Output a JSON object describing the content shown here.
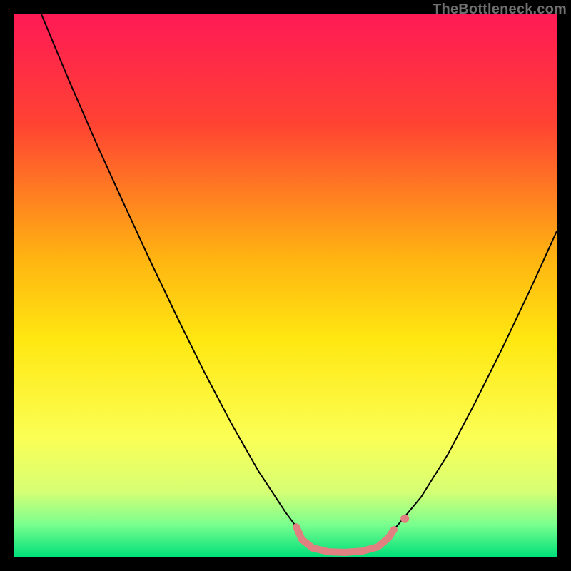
{
  "watermark": "TheBottleneck.com",
  "chart_data": {
    "type": "line",
    "title": "",
    "xlabel": "",
    "ylabel": "",
    "xlim": [
      0,
      100
    ],
    "ylim": [
      0,
      100
    ],
    "grid": false,
    "legend": false,
    "background_gradient_stops": [
      {
        "offset": 0.0,
        "color": "#ff1a55"
      },
      {
        "offset": 0.2,
        "color": "#ff4233"
      },
      {
        "offset": 0.45,
        "color": "#ffb411"
      },
      {
        "offset": 0.6,
        "color": "#ffe711"
      },
      {
        "offset": 0.78,
        "color": "#fbff55"
      },
      {
        "offset": 0.88,
        "color": "#d6ff74"
      },
      {
        "offset": 0.94,
        "color": "#7bff8e"
      },
      {
        "offset": 1.0,
        "color": "#00e07a"
      }
    ],
    "series": [
      {
        "name": "bottleneck-curve-left",
        "color": "#000000",
        "width": 2,
        "x": [
          5.0,
          10.0,
          15.0,
          20.0,
          25.0,
          30.0,
          35.0,
          40.0,
          45.0,
          50.0,
          52.0
        ],
        "y": [
          100.0,
          88.0,
          76.5,
          65.5,
          54.7,
          44.2,
          34.1,
          24.6,
          15.8,
          8.2,
          5.5
        ]
      },
      {
        "name": "bottleneck-curve-right",
        "color": "#000000",
        "width": 2,
        "x": [
          70.0,
          75.0,
          80.0,
          85.0,
          90.0,
          95.0,
          100.0
        ],
        "y": [
          5.0,
          11.0,
          19.0,
          28.5,
          38.5,
          49.0,
          60.0
        ]
      },
      {
        "name": "bottleneck-valley-band",
        "color": "#e08080",
        "width": 10,
        "x": [
          52.0,
          53.0,
          55.0,
          58.0,
          61.0,
          64.0,
          67.0,
          69.0,
          70.0
        ],
        "y": [
          5.5,
          3.2,
          1.6,
          0.9,
          0.8,
          1.0,
          1.8,
          3.5,
          5.0
        ]
      },
      {
        "name": "bottleneck-valley-marker",
        "color": "#e08080",
        "type": "scatter",
        "radius": 6,
        "x": [
          72.0
        ],
        "y": [
          7.0
        ]
      }
    ]
  }
}
